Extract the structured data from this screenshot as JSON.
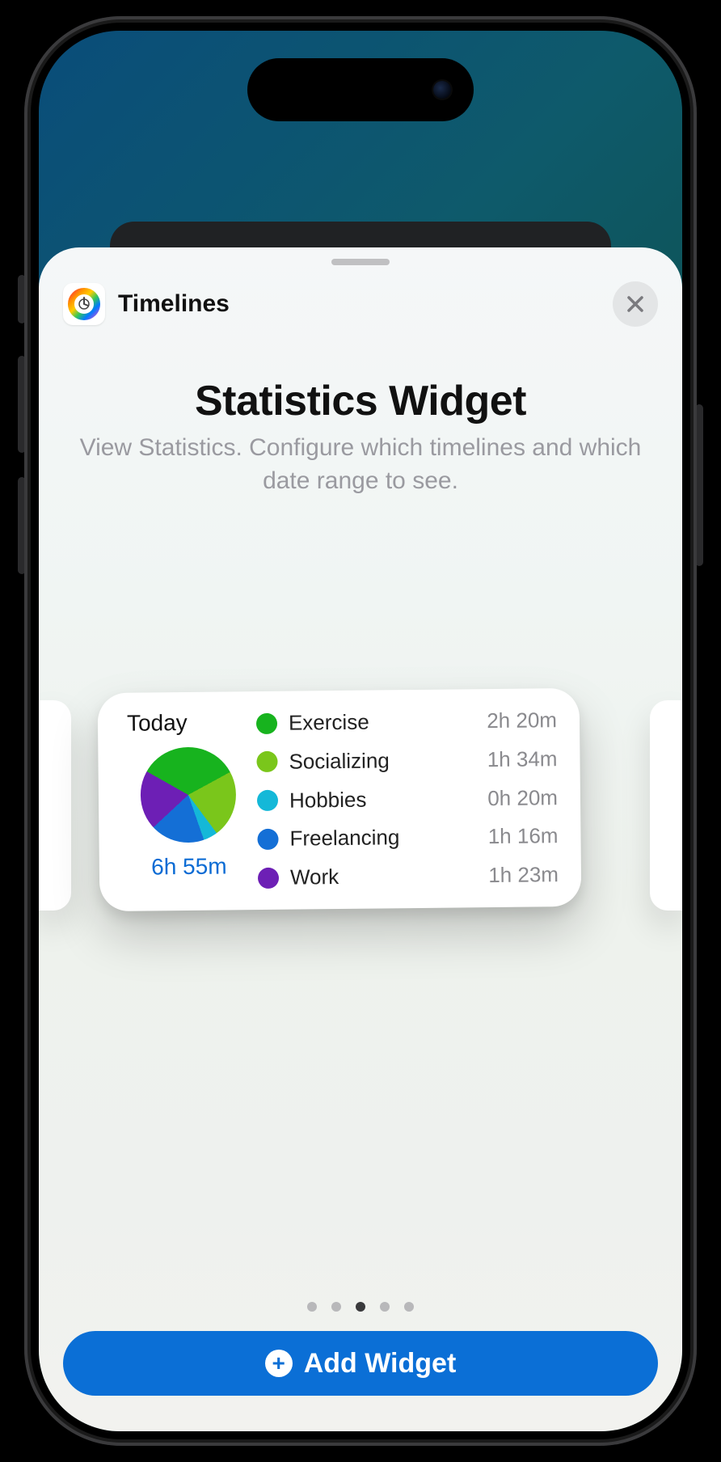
{
  "header": {
    "app_name": "Timelines"
  },
  "page": {
    "title": "Statistics Widget",
    "subtitle": "View Statistics. Configure which timelines and which date range to see."
  },
  "widget": {
    "period_label": "Today",
    "total_label": "6h 55m",
    "items": [
      {
        "name": "Exercise",
        "value": "2h 20m",
        "color": "#17b31e"
      },
      {
        "name": "Socializing",
        "value": "1h 34m",
        "color": "#7ac61b"
      },
      {
        "name": "Hobbies",
        "value": "0h 20m",
        "color": "#14b8d8"
      },
      {
        "name": "Freelancing",
        "value": "1h 16m",
        "color": "#146fd6"
      },
      {
        "name": "Work",
        "value": "1h 23m",
        "color": "#6d1fb5"
      }
    ]
  },
  "pager": {
    "count": 5,
    "active_index": 2
  },
  "cta": {
    "label": "Add Widget"
  },
  "chart_data": {
    "type": "pie",
    "title": "Today",
    "total_minutes": 415,
    "series": [
      {
        "name": "Exercise",
        "minutes": 140,
        "color": "#17b31e"
      },
      {
        "name": "Socializing",
        "minutes": 94,
        "color": "#7ac61b"
      },
      {
        "name": "Hobbies",
        "minutes": 20,
        "color": "#14b8d8"
      },
      {
        "name": "Freelancing",
        "minutes": 76,
        "color": "#146fd6"
      },
      {
        "name": "Work",
        "minutes": 83,
        "color": "#6d1fb5"
      }
    ]
  }
}
